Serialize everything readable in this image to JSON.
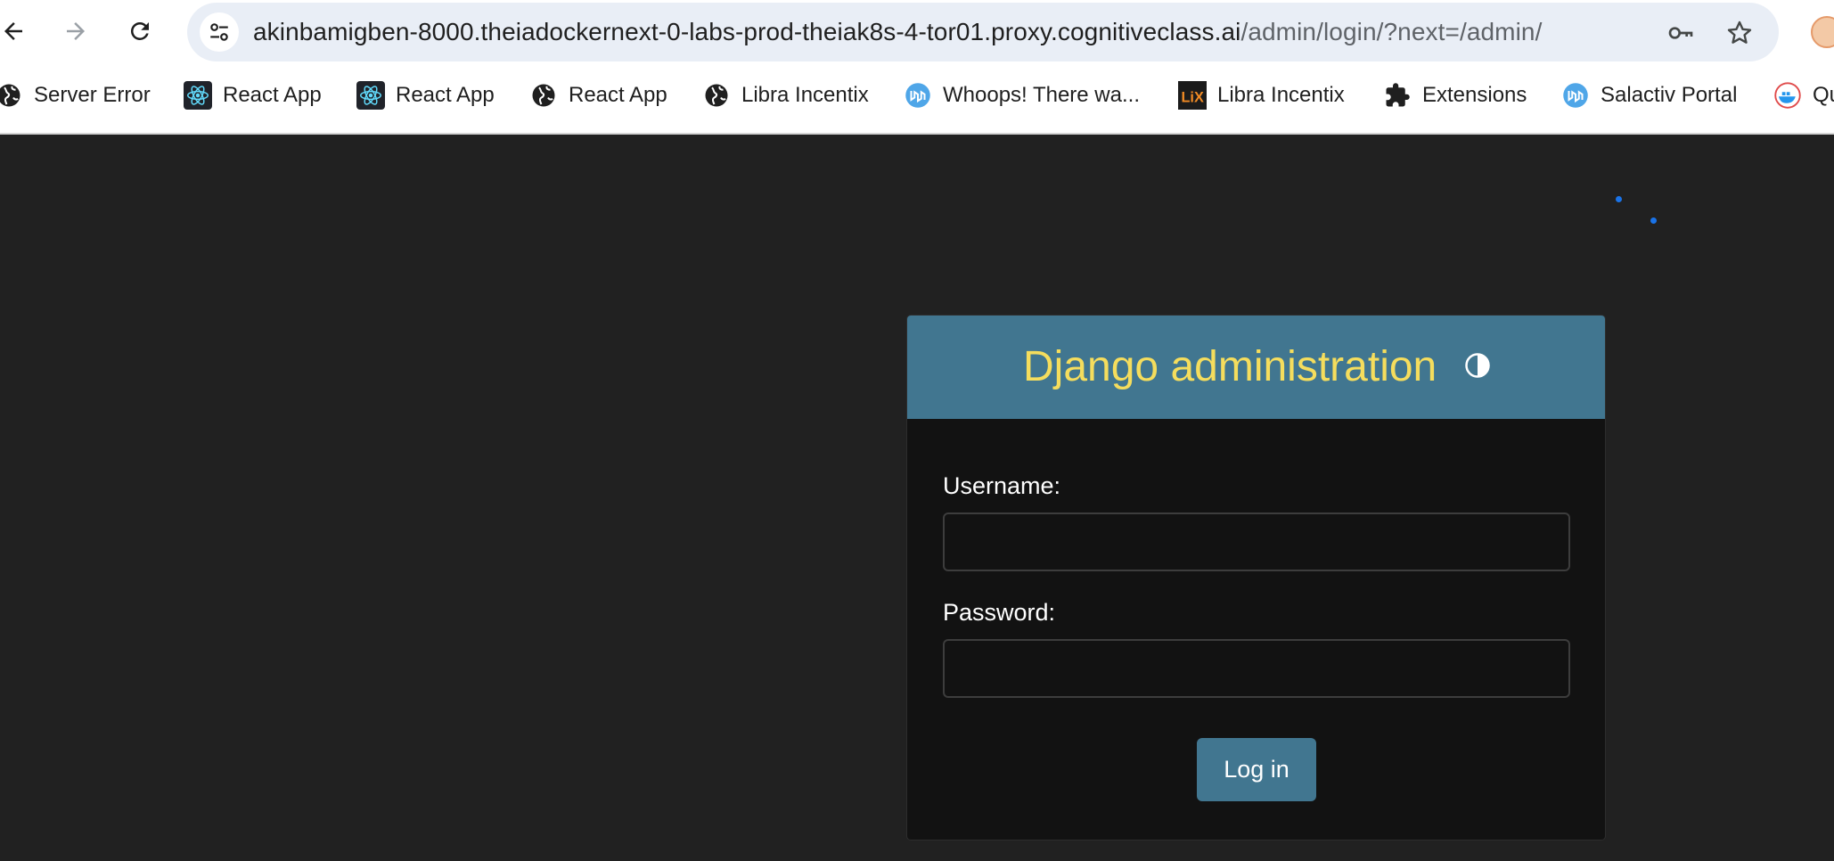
{
  "browser": {
    "url_host": "akinbamigben-8000.theiadockernext-0-labs-prod-theiak8s-4-tor01.proxy.cognitiveclass.ai",
    "url_path": "/admin/login/?next=/admin/"
  },
  "bookmarks": [
    {
      "label": "Server Error",
      "icon": "globe-icon"
    },
    {
      "label": "React App",
      "icon": "react-icon"
    },
    {
      "label": "React App",
      "icon": "react-icon"
    },
    {
      "label": "React App",
      "icon": "globe-icon"
    },
    {
      "label": "Libra Incentix",
      "icon": "globe-icon"
    },
    {
      "label": "Whoops! There wa...",
      "icon": "laravel-icon"
    },
    {
      "label": "Libra Incentix",
      "icon": "lix-icon"
    },
    {
      "label": "Extensions",
      "icon": "puzzle-icon"
    },
    {
      "label": "Salactiv Portal",
      "icon": "laravel-icon"
    },
    {
      "label": "Qu",
      "icon": "docker-icon"
    }
  ],
  "login": {
    "site_title": "Django administration",
    "username_label": "Username:",
    "username_value": "",
    "password_label": "Password:",
    "password_value": "",
    "submit_label": "Log in"
  },
  "colors": {
    "header_bg": "#417690",
    "header_title": "#f5dd5d",
    "page_bg": "#212121",
    "panel_bg": "#121212",
    "button_bg": "#417690"
  }
}
